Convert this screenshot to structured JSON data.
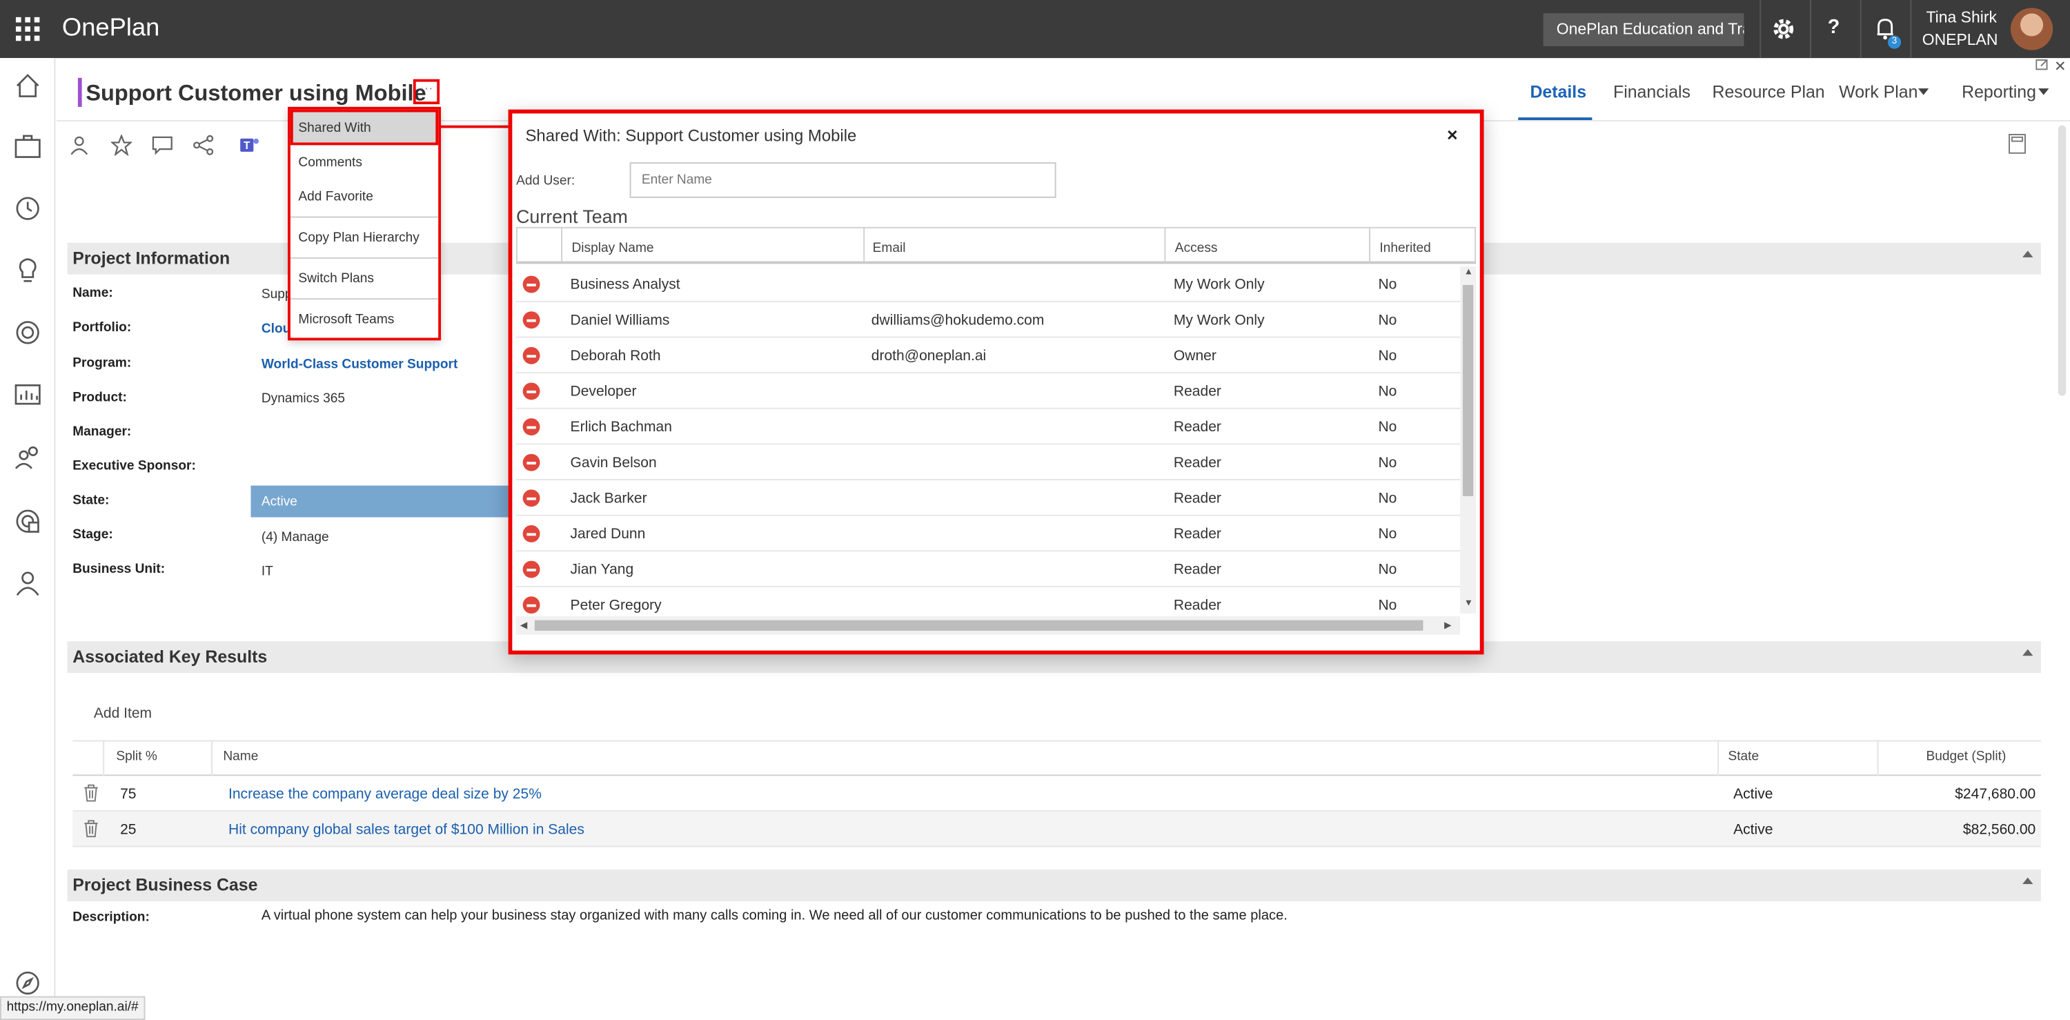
{
  "app": {
    "name": "OnePlan",
    "org_selector": "OnePlan Education and Trai",
    "notifications": "3",
    "user_name": "Tina Shirk",
    "user_org": "ONEPLAN"
  },
  "rail": {
    "icons": [
      "home-icon",
      "briefcase-icon",
      "history-icon",
      "lightbulb-icon",
      "target-icon",
      "dashboard-icon",
      "people-icon",
      "resource-icon",
      "user-icon",
      "compass-icon"
    ]
  },
  "page": {
    "title": "Support Customer using Mobile",
    "ellipsis": "···",
    "tabs": [
      "Details",
      "Financials",
      "Resource Plan",
      "Work Plan",
      "Reporting"
    ],
    "active_tab": "Details"
  },
  "project_info": {
    "header": "Project Information",
    "fields": [
      {
        "label": "Name:",
        "value": "Supp"
      },
      {
        "label": "Portfolio:",
        "value": "Clou"
      },
      {
        "label": "Program:",
        "value": "World-Class Customer Support"
      },
      {
        "label": "Product:",
        "value": "Dynamics 365"
      },
      {
        "label": "Manager:",
        "value": ""
      },
      {
        "label": "Executive Sponsor:",
        "value": ""
      },
      {
        "label": "State:",
        "value": "Active"
      },
      {
        "label": "Stage:",
        "value": "(4) Manage"
      },
      {
        "label": "Business Unit:",
        "value": "IT"
      }
    ]
  },
  "key_results": {
    "header": "Associated Key Results",
    "add_item": "Add Item",
    "columns": [
      "Split %",
      "Name",
      "State",
      "Budget (Split)"
    ],
    "rows": [
      {
        "split": "75",
        "name": "Increase the company average deal size by 25%",
        "state": "Active",
        "budget": "$247,680.00"
      },
      {
        "split": "25",
        "name": "Hit company global sales target of $100 Million in Sales",
        "state": "Active",
        "budget": "$82,560.00"
      }
    ]
  },
  "business_case": {
    "header": "Project Business Case",
    "desc_label": "Description:",
    "desc_value": "A virtual phone system can help your business stay organized with many calls coming in.  We need all of our customer communications to be pushed to the same place."
  },
  "menu": {
    "items": [
      "Shared With",
      "Comments",
      "Add Favorite",
      "Copy Plan Hierarchy",
      "Switch Plans",
      "Microsoft Teams"
    ]
  },
  "dialog": {
    "title": "Shared With: Support Customer using Mobile",
    "close": "×",
    "add_user_label": "Add User:",
    "add_user_placeholder": "Enter Name",
    "current_team": "Current Team",
    "columns": [
      "Display Name",
      "Email",
      "Access",
      "Inherited"
    ],
    "rows": [
      {
        "name": "Business Analyst",
        "email": "",
        "access": "My Work Only",
        "inherited": "No"
      },
      {
        "name": "Daniel Williams",
        "email": "dwilliams@hokudemo.com",
        "access": "My Work Only",
        "inherited": "No"
      },
      {
        "name": "Deborah Roth",
        "email": "droth@oneplan.ai",
        "access": "Owner",
        "inherited": "No"
      },
      {
        "name": "Developer",
        "email": "",
        "access": "Reader",
        "inherited": "No"
      },
      {
        "name": "Erlich Bachman",
        "email": "",
        "access": "Reader",
        "inherited": "No"
      },
      {
        "name": "Gavin Belson",
        "email": "",
        "access": "Reader",
        "inherited": "No"
      },
      {
        "name": "Jack Barker",
        "email": "",
        "access": "Reader",
        "inherited": "No"
      },
      {
        "name": "Jared Dunn",
        "email": "",
        "access": "Reader",
        "inherited": "No"
      },
      {
        "name": "Jian Yang",
        "email": "",
        "access": "Reader",
        "inherited": "No"
      },
      {
        "name": "Peter Gregory",
        "email": "",
        "access": "Reader",
        "inherited": "No"
      }
    ]
  },
  "status_url": "https://my.oneplan.ai/#"
}
